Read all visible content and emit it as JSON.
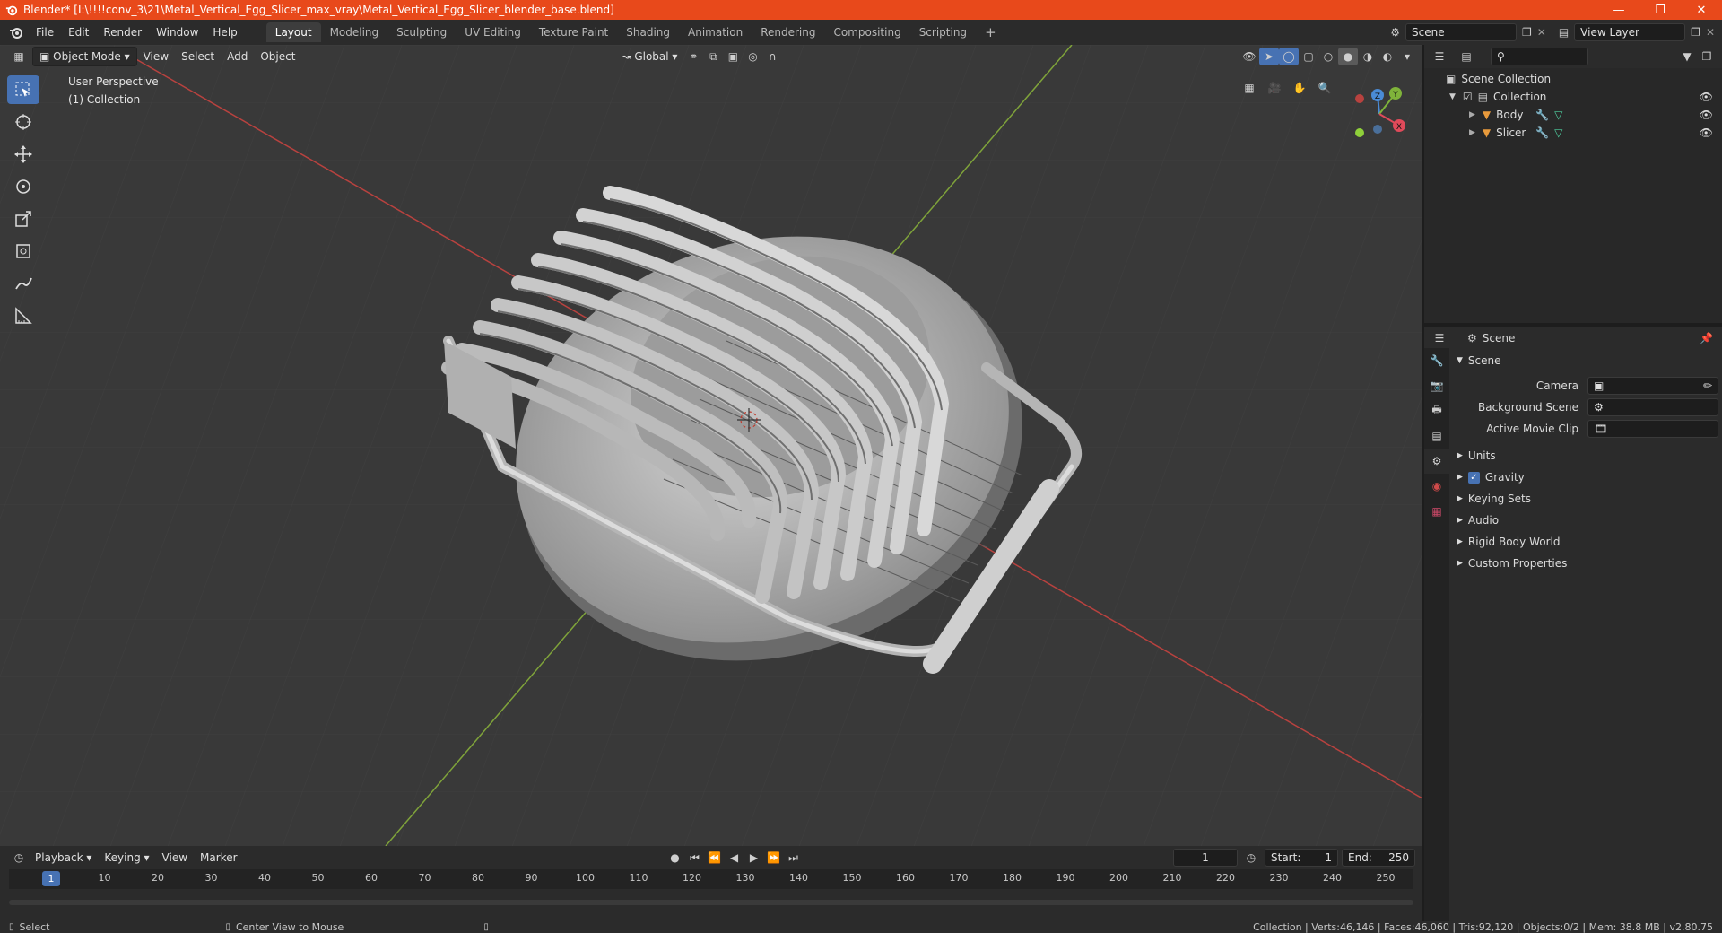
{
  "window": {
    "title": "Blender* [I:\\!!!!conv_3\\21\\Metal_Vertical_Egg_Slicer_max_vray\\Metal_Vertical_Egg_Slicer_blender_base.blend]",
    "accent": "#e8491b"
  },
  "menu": [
    "File",
    "Edit",
    "Render",
    "Window",
    "Help"
  ],
  "workspaces": [
    "Layout",
    "Modeling",
    "Sculpting",
    "UV Editing",
    "Texture Paint",
    "Shading",
    "Animation",
    "Rendering",
    "Compositing",
    "Scripting"
  ],
  "active_workspace": "Layout",
  "add_workspace": "+",
  "scene_selector": {
    "label": "Scene"
  },
  "view_layer_selector": {
    "label": "View Layer"
  },
  "viewport": {
    "mode": "Object Mode",
    "menus": [
      "View",
      "Select",
      "Add",
      "Object"
    ],
    "orientation": "Global",
    "info_line1": "User Perspective",
    "info_line2": "(1) Collection",
    "gizmo": {
      "x": "X",
      "y": "Y",
      "z": "Z"
    },
    "x_axis_color": "#b8423f",
    "y_axis_color": "#7fa33a"
  },
  "outliner": {
    "search_placeholder": "",
    "root": "Scene Collection",
    "collection": "Collection",
    "objects": [
      "Body",
      "Slicer"
    ]
  },
  "properties": {
    "context": "Scene",
    "panel": "Scene",
    "camera_label": "Camera",
    "bg_scene_label": "Background Scene",
    "movie_clip_label": "Active Movie Clip",
    "subpanels": [
      "Units",
      "Gravity",
      "Keying Sets",
      "Audio",
      "Rigid Body World",
      "Custom Properties"
    ],
    "gravity_checked": true
  },
  "timeline": {
    "menus": [
      "Playback",
      "Keying",
      "View",
      "Marker"
    ],
    "current_frame": "1",
    "start_label": "Start:",
    "start_value": "1",
    "end_label": "End:",
    "end_value": "250",
    "ruler": [
      "1",
      "10",
      "20",
      "30",
      "40",
      "50",
      "60",
      "70",
      "80",
      "90",
      "100",
      "110",
      "120",
      "130",
      "140",
      "150",
      "160",
      "170",
      "180",
      "190",
      "200",
      "210",
      "220",
      "230",
      "240",
      "250"
    ]
  },
  "status": {
    "left_action": "Select",
    "middle_action": "Center View to Mouse",
    "stats": "Collection | Verts:46,146 | Faces:46,060 | Tris:92,120 | Objects:0/2 | Mem: 38.8 MB | v2.80.75"
  }
}
